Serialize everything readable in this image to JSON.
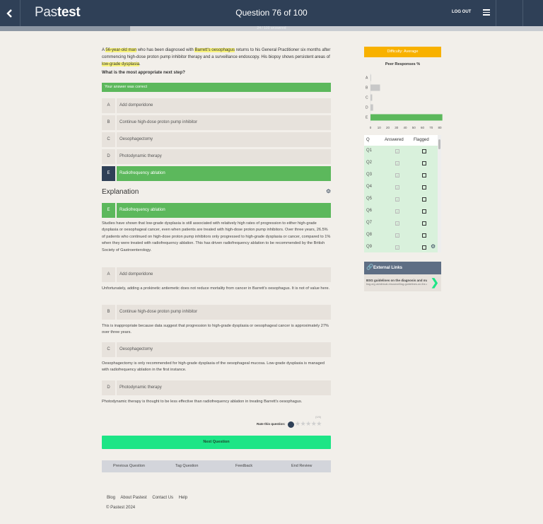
{
  "header": {
    "logo_light": "Pas",
    "logo_bold": "test",
    "title": "Question 76 of 100",
    "logout_label": "LOG OUT",
    "back_icon": "chevron-left-icon",
    "menu_icon": "hamburger-icon"
  },
  "progress": {
    "fraction": 0.24,
    "label": "24 / 100 answered"
  },
  "question": {
    "stem_parts": [
      {
        "text": "A ",
        "hl": false
      },
      {
        "text": "56-year-old man",
        "hl": true
      },
      {
        "text": " who has been diagnosed with ",
        "hl": false
      },
      {
        "text": "Barrett's oesophagus",
        "hl": true
      },
      {
        "text": " returns to his General Practitioner six months after commencing high-dose proton pump inhibitor therapy and a surveillance endoscopy. His biopsy shows persistent areas of ",
        "hl": false
      },
      {
        "text": "low-grade dysplasia",
        "hl": true
      },
      {
        "text": ".",
        "hl": false
      }
    ],
    "ask": "What is the most appropriate next step?",
    "result_banner": "Your answer was correct"
  },
  "options": [
    {
      "letter": "A",
      "text": "Add domperidone"
    },
    {
      "letter": "B",
      "text": "Continue high-dose proton pump inhibitor"
    },
    {
      "letter": "C",
      "text": "Oesophagectomy"
    },
    {
      "letter": "D",
      "text": "Photodynamic therapy"
    },
    {
      "letter": "E",
      "text": "Radiofrequency ablation"
    }
  ],
  "explanation": {
    "title": "Explanation",
    "correct_letter": "E",
    "correct_text": "Radiofrequency ablation",
    "correct_para": "Studies have shown that low-grade dysplasia is still associated with relatively high rates of progression to either high-grade dysplasia or oesophageal cancer, even when patients are treated with high-dose proton pump inhibitors. Over three years, 26.5% of patients who continued on high-dose proton pump inhibitors only progressed to high-grade dysplasia or cancer, compared to 1% when they were treated with radiofrequency ablation. This has driven radiofrequency ablation to be recommended by the British Society of Gastroenterology.",
    "items": [
      {
        "letter": "A",
        "text": "Add domperidone",
        "para": "Unfortunately, adding a prokinetic antiemetic does not reduce mortality from cancer in Barrett's oesophagus. It is not of value here."
      },
      {
        "letter": "B",
        "text": "Continue high-dose proton pump inhibitor",
        "para": "This is inappropriate because data suggest that progression to high-grade dysplasia or oesophageal cancer is approximately 27% over three years."
      },
      {
        "letter": "C",
        "text": "Oesophagectomy",
        "para": "Oesophagectomy is only recommended for high-grade dysplasia of the oesophageal mucosa. Low-grade dysplasia is managed with radiofrequency ablation in the first instance."
      },
      {
        "letter": "D",
        "text": "Photodynamic therapy",
        "para": "Photodynamic therapy is thought to be less effective than radiofrequency ablation in treating Barrett's oesophagus."
      }
    ]
  },
  "rating": {
    "label": "Rate this question:",
    "small": "(0/5)",
    "stars": "★★★★★"
  },
  "next_button": "Next Question",
  "bottom_nav": [
    "Previous Question",
    "Tag Question",
    "Feedback",
    "End Review"
  ],
  "footer": {
    "links": [
      "Blog",
      "About Pastest",
      "Contact Us",
      "Help"
    ],
    "copyright": "© Pastest 2024"
  },
  "sidebar": {
    "difficulty": "Difficulty: Average",
    "peer_title": "Peer Responses %",
    "table_head": {
      "q": "Q",
      "answered": "Answered",
      "flagged": "Flagged"
    },
    "rows": [
      "Q1",
      "Q2",
      "Q3",
      "Q4",
      "Q5",
      "Q6",
      "Q7",
      "Q8",
      "Q9"
    ],
    "external_title": "External Links",
    "external_link": "BSG guidelines on the diagnosis and management of Barrett's oesophagus",
    "external_sub": "bsg.org.uk/clinical-resource/bsg-guidelines-on-the-diagnosis"
  },
  "chart_data": {
    "type": "bar",
    "orientation": "horizontal",
    "title": "Peer Responses %",
    "categories": [
      "A",
      "B",
      "C",
      "D",
      "E"
    ],
    "values": [
      0,
      11,
      2,
      3,
      83
    ],
    "xlim": [
      0,
      80
    ],
    "xticks": [
      0,
      10,
      20,
      30,
      40,
      50,
      60,
      70,
      80
    ],
    "colors": {
      "highlight": "#5cb85c",
      "default": "#c8c8c8"
    },
    "highlight_category": "E"
  },
  "colors": {
    "navy": "#2f4057",
    "green": "#5cb85c",
    "mint": "#1de586",
    "amber": "#f8b100"
  }
}
